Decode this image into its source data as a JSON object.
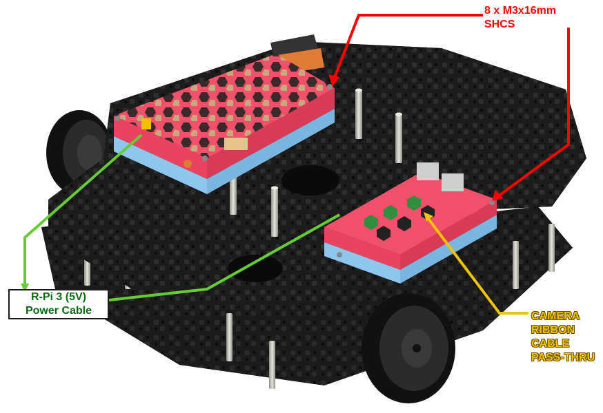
{
  "callouts": {
    "screws": {
      "line1": "8 x M3x16mm",
      "line2": "SHCS",
      "color": "#ff0000"
    },
    "power": {
      "line1": "R-Pi 3 (5V)",
      "line2": "Power Cable",
      "color": "#0c6a13",
      "leader_color": "#66cc33"
    },
    "camera": {
      "line1": "CAMERA",
      "line2": "RIBBON",
      "line3": "CABLE",
      "line4": "PASS-THRU",
      "color": "#f2c200"
    }
  },
  "colors": {
    "chassis": "#1c1c1c",
    "case_top": "#f0506a",
    "case_bottom": "#8ec6ee",
    "standoff": "#c9c9c2",
    "tire": "#111111",
    "hub": "#2b2b2b"
  }
}
